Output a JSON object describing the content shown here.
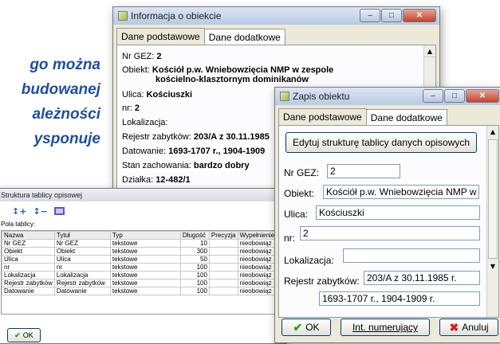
{
  "bg_lines": [
    "go  można",
    "budowanej",
    "ależności",
    "ysponuje"
  ],
  "info_window": {
    "title": "Informacja o obiekcie",
    "tabs": [
      "Dane podstawowe",
      "Dane dodatkowe"
    ],
    "fields": [
      {
        "label": "Nr GEZ:",
        "value": "2"
      },
      {
        "label": "Obiekt:",
        "value": "Kościół p.w. Wniebowzięcia NMP w zespole",
        "value2": "kościelno-klasztornym dominikanów"
      },
      {
        "label": "Ulica:",
        "value": "Kościuszki"
      },
      {
        "label": "nr:",
        "value": "2"
      },
      {
        "label": "Lokalizacja:",
        "value": ""
      },
      {
        "label": "Rejestr zabytków:",
        "value": "203/A z 30.11.1985"
      },
      {
        "label": "Datowanie:",
        "value": "1693-1707 r., 1904-1909"
      },
      {
        "label": "Stan zachowania:",
        "value": "bardzo dobry"
      },
      {
        "label": "Działka:",
        "value": "12-482/1"
      }
    ]
  },
  "struct_window": {
    "title": "Struktura tablicy opisowej",
    "section_label": "Pola tablicy:",
    "ok_label": "OK",
    "columns": [
      "Nazwa",
      "Tytuł",
      "Typ",
      "Długość",
      "Precyzja",
      "Wypełnienie"
    ],
    "rows": [
      [
        "Nr GEZ",
        "Nr GEZ",
        "tekstowe",
        "10",
        "",
        "nieobowiąz"
      ],
      [
        "Obiekt",
        "Obiekt",
        "tekstowe",
        "300",
        "",
        "nieobowiąz"
      ],
      [
        "Ulica",
        "Ulica",
        "tekstowe",
        "50",
        "",
        "nieobowiąz"
      ],
      [
        "nr",
        "nr",
        "tekstowe",
        "100",
        "",
        "nieobowiąz"
      ],
      [
        "Lokalizacja",
        "Lokalizacja",
        "tekstowe",
        "100",
        "",
        "nieobowiąz"
      ],
      [
        "Rejestr zabytków",
        "Rejestr zabytków",
        "tekstowe",
        "100",
        "",
        "nieobowiąz"
      ],
      [
        "Datowanie",
        "Datowanie",
        "tekstowe",
        "100",
        "",
        "nieobowiąz"
      ]
    ]
  },
  "save_window": {
    "title": "Zapis obiektu",
    "tabs": [
      "Dane podstawowe",
      "Dane dodatkowe"
    ],
    "edit_button": "Edytuj strukturę tablicy danych opisowych",
    "fields": [
      {
        "label": "Nr GEZ:",
        "value": "2"
      },
      {
        "label": "Obiekt:",
        "value": "Kościół p.w. Wniebowzięcia NMP w ze"
      },
      {
        "label": "Ulica:",
        "value": "Kościuszki"
      },
      {
        "label": "nr:",
        "value": "2"
      },
      {
        "label": "Lokalizacja:",
        "value": ""
      },
      {
        "label": "Rejestr zabytków:",
        "value": "203/A z 30.11.1985 r."
      },
      {
        "label": "",
        "value": "1693-1707 r., 1904-1909 r."
      }
    ],
    "ok_label": "OK",
    "numbering_label": "Int. numerujący",
    "cancel_label": "Anuluj"
  }
}
